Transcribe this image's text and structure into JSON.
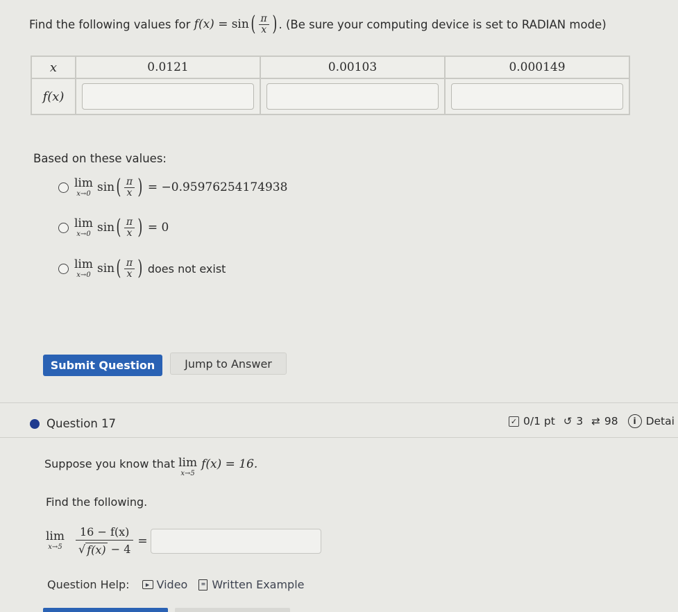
{
  "prompt": {
    "lead": "Find the following values for",
    "func_lhs": "f(x) =",
    "func_name": "sin",
    "frac_num": "π",
    "frac_den": "x",
    "trail": ". (Be sure your computing device is set to RADIAN mode)"
  },
  "table": {
    "row_x_label": "x",
    "row_f_label": "f(x)",
    "x_values": [
      "0.0121",
      "0.00103",
      "0.000149"
    ],
    "f_values": [
      "",
      "",
      ""
    ]
  },
  "based_label": "Based on these values:",
  "limit": {
    "lim": "lim",
    "sub": "x→0",
    "func": "sin",
    "num": "π",
    "den": "x"
  },
  "options": [
    {
      "suffix": "= −0.95976254174938",
      "selected": false
    },
    {
      "suffix": "= 0",
      "selected": false
    },
    {
      "suffix": "does not exist",
      "selected": false
    }
  ],
  "buttons": {
    "submit": "Submit Question",
    "jump": "Jump to Answer"
  },
  "question": {
    "title": "Question 17",
    "score": "0/1 pt",
    "retries": "3",
    "attempts": "98",
    "details": "Detai",
    "suppose_lead": "Suppose you know that",
    "suppose_lim": "lim",
    "suppose_sub": "x→5",
    "suppose_expr": "f(x) = 16.",
    "find": "Find the following.",
    "expr_lim": "lim",
    "expr_sub": "x→5",
    "expr_num": "16 − f(x)",
    "expr_den_rad": "f(x)",
    "expr_den_tail": "− 4",
    "equals": "=",
    "answer_value": "",
    "help_label": "Question Help:",
    "help_video": "Video",
    "help_written": "Written Example"
  },
  "colors": {
    "primary": "#2a62b4",
    "question_dot": "#1f3b8f",
    "background": "#e9e9e5"
  }
}
